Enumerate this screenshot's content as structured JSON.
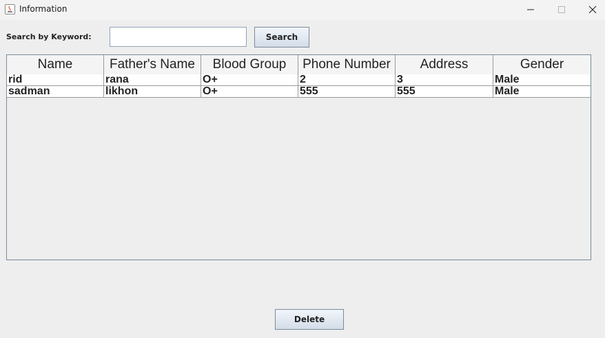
{
  "window": {
    "title": "Information",
    "icons": {
      "app": "java-icon",
      "minimize": "minimize-icon",
      "maximize": "maximize-icon",
      "close": "close-icon"
    }
  },
  "search": {
    "label": "Search by Keyword:",
    "value": "",
    "placeholder": "",
    "button_label": "Search"
  },
  "table": {
    "columns": [
      "Name",
      "Father's Name",
      "Blood Group",
      "Phone Number",
      "Address",
      "Gender"
    ],
    "rows": [
      [
        "rid",
        "rana",
        "O+",
        "2",
        "3",
        "Male"
      ],
      [
        "sadman",
        "likhon",
        "O+",
        "555",
        "555",
        "Male"
      ]
    ]
  },
  "footer": {
    "delete_label": "Delete"
  },
  "colors": {
    "background": "#eeeeee",
    "titlebar": "#f3f3f3",
    "button_gradient_top": "#f2f6fb",
    "button_gradient_bottom": "#d3dde8",
    "border": "#7a8a99"
  }
}
